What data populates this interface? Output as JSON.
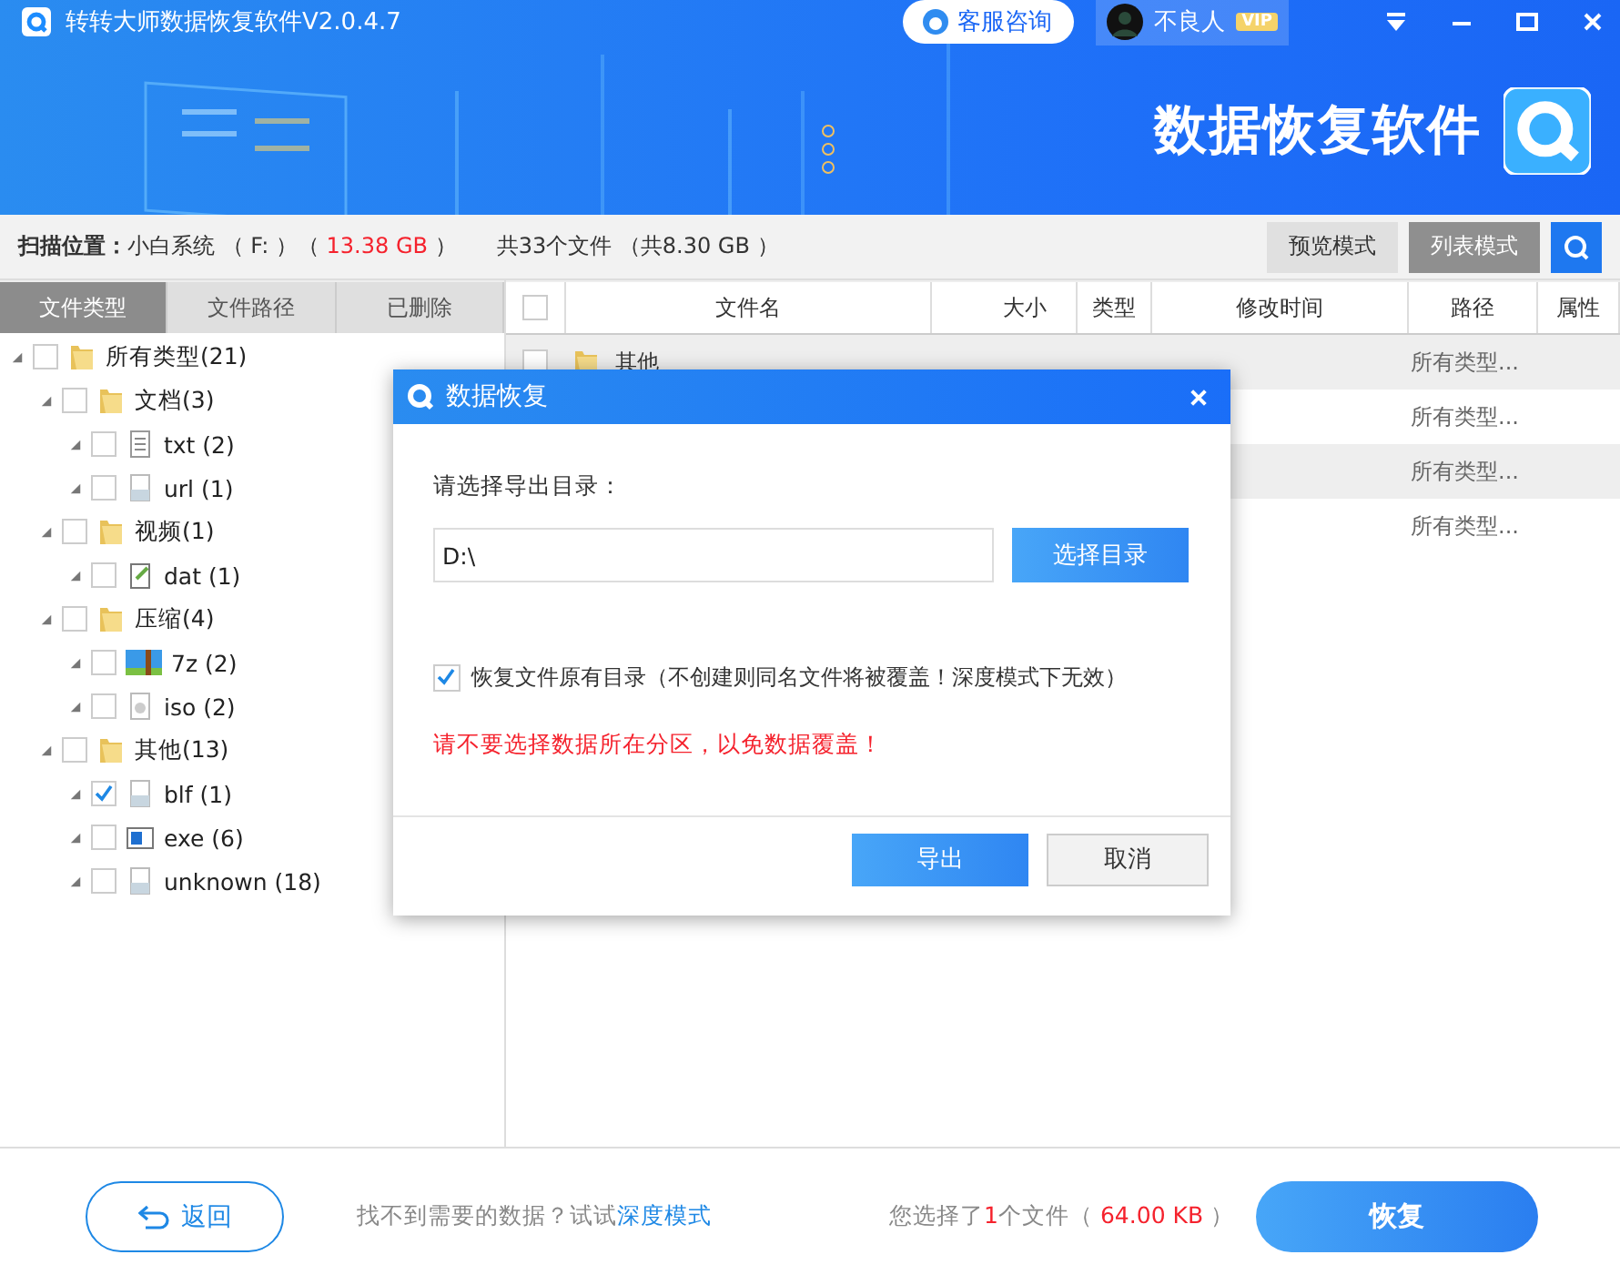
{
  "window": {
    "title": "转转大师数据恢复软件V2.0.4.7",
    "service_button": "客服咨询",
    "user_name": "不良人",
    "user_badge": "VIP"
  },
  "banner": {
    "title": "数据恢复软件"
  },
  "scan_bar": {
    "label": "扫描位置：",
    "location": "小白系统 （ F: ）（ ",
    "location_size": "13.38 GB",
    "location_end": " ）",
    "summary": "共33个文件 （共8.30 GB ）",
    "view_modes": [
      {
        "label": "预览模式",
        "selected": false
      },
      {
        "label": "列表模式",
        "selected": true
      }
    ]
  },
  "sidebar": {
    "tabs": [
      {
        "label": "文件类型",
        "selected": true
      },
      {
        "label": "文件路径",
        "selected": false
      },
      {
        "label": "已删除",
        "selected": false
      }
    ],
    "tree": [
      {
        "label": "所有类型(21)",
        "kind": "folder",
        "checked": false,
        "children": [
          {
            "label": "文档(3)",
            "kind": "folder",
            "checked": false,
            "children": [
              {
                "label": "txt (2)",
                "kind": "text",
                "checked": false
              },
              {
                "label": "url (1)",
                "kind": "file",
                "checked": false
              }
            ]
          },
          {
            "label": "视频(1)",
            "kind": "folder",
            "checked": false,
            "children": [
              {
                "label": "dat (1)",
                "kind": "edit",
                "checked": false
              }
            ]
          },
          {
            "label": "压缩(4)",
            "kind": "folder",
            "checked": false,
            "children": [
              {
                "label": "7z (2)",
                "kind": "archive",
                "checked": false
              },
              {
                "label": "iso (2)",
                "kind": "disc",
                "checked": false
              }
            ]
          },
          {
            "label": "其他(13)",
            "kind": "folder",
            "checked": false,
            "children": [
              {
                "label": "blf (1)",
                "kind": "file",
                "checked": true
              },
              {
                "label": "exe (6)",
                "kind": "program",
                "checked": false
              },
              {
                "label": "unknown (18)",
                "kind": "file",
                "checked": false
              }
            ]
          }
        ]
      }
    ]
  },
  "table": {
    "select_all_checked": false,
    "columns": [
      "文件名",
      "大小",
      "类型",
      "修改时间",
      "路径",
      "属性"
    ],
    "rows": [
      {
        "name": "其他",
        "checked": false,
        "path": "所有类型..."
      },
      {
        "path": "所有类型..."
      },
      {
        "path": "所有类型..."
      },
      {
        "path": "所有类型..."
      }
    ]
  },
  "dialog": {
    "title": "数据恢复",
    "prompt": "请选择导出目录：",
    "directory": "D:\\",
    "browse_button": "选择目录",
    "keep_structure": {
      "label": "恢复文件原有目录（不创建则同名文件将被覆盖！深度模式下无效）",
      "checked": true
    },
    "warning": "请不要选择数据所在分区，以免数据覆盖！",
    "export_button": "导出",
    "cancel_button": "取消"
  },
  "footer": {
    "back_button": "返回",
    "hint": "找不到需要的数据？试试",
    "hint_link": "深度模式",
    "selection_prefix": "您选择了",
    "selection_count": "1",
    "selection_middle": "个文件（ ",
    "selection_size": "64.00 KB",
    "selection_end": " ）",
    "recover_button": "恢复"
  }
}
